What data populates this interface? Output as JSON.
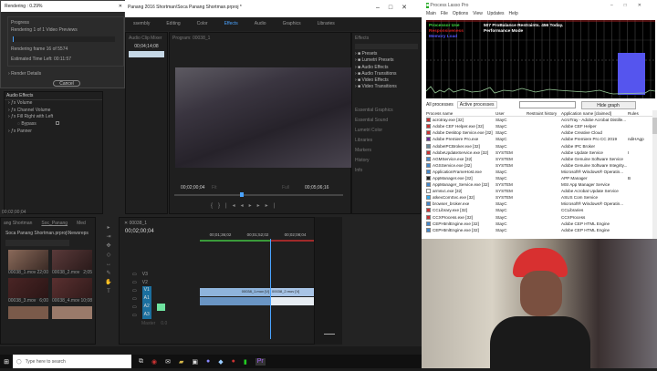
{
  "premiere": {
    "title": "Panang 2016 Shortman\\Soca Panang Shortman.prproj *",
    "workspaces": [
      "ssembly",
      "Editing",
      "Color",
      "Effects",
      "Audio",
      "Graphics",
      "Libraries"
    ],
    "audio_clip_mixer": {
      "title": "Audio Clip Mixer",
      "timecode": "00;04;14;08"
    },
    "program": {
      "title": "Program: 00038_1",
      "timecode_left": "00;02;00;04",
      "fit": "Fit",
      "quality": "Full",
      "timecode_right": "00;05;06;16"
    },
    "effects": {
      "title": "Effects",
      "items": [
        "Presets",
        "Lumetri Presets",
        "Audio Effects",
        "Audio Transitions",
        "Video Effects",
        "Video Transitions"
      ]
    },
    "side_panels": [
      "Essential Graphics",
      "Essential Sound",
      "Lumetri Color",
      "Libraries",
      "Markers",
      "History",
      "Info"
    ],
    "source_timecode": "00;02;00;04",
    "audio_effects": {
      "title": "Audio Effects",
      "items": [
        "Volume",
        "Channel Volume",
        "Fill Right with Left",
        "Bypass",
        "Panner"
      ]
    },
    "project": {
      "tabs": [
        "ang Shortman",
        "Soc_Panang",
        "Med"
      ],
      "path": "Soca Panang Shortman.prproj\\Newsreps",
      "clips": [
        {
          "name": "00038_1.mov",
          "dur": "22;00"
        },
        {
          "name": "00038_2.mov",
          "dur": "2;05"
        },
        {
          "name": "00038_3.mov",
          "dur": "6;00"
        },
        {
          "name": "00038_4.mov",
          "dur": "10;08"
        }
      ]
    },
    "timeline": {
      "tab": "00038_1",
      "timecode": "00;02;00;04",
      "ruler": [
        "00;01;36;02",
        "00;01;52;02",
        "00;02;08;04"
      ],
      "tracks": [
        "V3",
        "V2",
        "V1",
        "A1",
        "A2",
        "A3"
      ],
      "master": "Master",
      "master_val": "0.0",
      "clip1": "00038_1.mov [V]",
      "clip2": "00038_2.mov [V]"
    }
  },
  "render_dialog": {
    "title": "Rendering : 0.29%",
    "progress_label": "Progress",
    "line1": "Rendering 1 of 1 Video Previews",
    "line2": "Rendering frame 16 of 5574",
    "line3": "Estimated Time Left: 00:11:57",
    "details": "Render Details",
    "cancel": "Cancel",
    "progress": 0.29
  },
  "process_lasso": {
    "title": "Process Lasso Pro",
    "menu": [
      "Main",
      "File",
      "Options",
      "View",
      "Updates",
      "Help"
    ],
    "legend": [
      "Processor Use",
      "Responsiveness",
      "Memory Load"
    ],
    "status1": "507 ProBalance Restraints. 456 Today.",
    "status2": "Performance Mode",
    "tabs": [
      "All processes",
      "Active processes"
    ],
    "hide_graph": "Hide graph",
    "columns": [
      "Process name",
      "User",
      "Restraint history",
      "Application name [claimed]",
      "Rules"
    ],
    "rows": [
      [
        "acrotray.exe [32]",
        "StayC",
        "",
        "AcroTray - Adobe Acrobat Distille...",
        ""
      ],
      [
        "Adobe CEF Helper.exe [32]",
        "StayC",
        "",
        "Adobe CEF Helper",
        ""
      ],
      [
        "Adobe Desktop Service.exe [32]",
        "StayC",
        "",
        "Adobe Creative Cloud",
        ""
      ],
      [
        "Adobe Premiere Pro.exe",
        "StayC",
        "",
        "Adobe Premiere Pro CC 2019",
        "ndiHAgp"
      ],
      [
        "AdobeIPCBroker.exe [32]",
        "StayC",
        "",
        "Adobe IPC Broker",
        ""
      ],
      [
        "AdobeUpdateService.exe [32]",
        "SYSTEM",
        "",
        "Adobe Update Service",
        "I"
      ],
      [
        "AGMService.exe [32]",
        "SYSTEM",
        "",
        "Adobe Genuine Software Service",
        ""
      ],
      [
        "AGSService.exe [32]",
        "SYSTEM",
        "",
        "Adobe Genuine Software Integrity...",
        ""
      ],
      [
        "ApplicationFrameHost.exe",
        "StayC",
        "",
        "Microsoft® Windows® Operatin...",
        ""
      ],
      [
        "AppManager.exe [32]",
        "StayC",
        "",
        "APP Manager",
        "B"
      ],
      [
        "AppManager_Service.exe [32]",
        "SYSTEM",
        "",
        "MSI App Manager Service",
        ""
      ],
      [
        "armsvc.exe [32]",
        "SYSTEM",
        "",
        "Adobe Acrobat Update Service",
        ""
      ],
      [
        "atkexComSvc.exe [32]",
        "SYSTEM",
        "",
        "ASUS Com Service",
        ""
      ],
      [
        "browser_broker.exe",
        "StayC",
        "",
        "Microsoft® Windows® Operatin...",
        ""
      ],
      [
        "CCLibrary.exe [32]",
        "StayC",
        "",
        "CCLibraries",
        ""
      ],
      [
        "CCXProcess.exe [32]",
        "StayC",
        "",
        "CCXProcess",
        ""
      ],
      [
        "CEPHtmlEngine.exe [32]",
        "StayC",
        "",
        "Adobe CEP HTML Engine",
        ""
      ],
      [
        "CEPHtmlEngine.exe [32]",
        "StayC",
        "",
        "Adobe CEP HTML Engine",
        ""
      ]
    ]
  },
  "taskbar": {
    "search_placeholder": "Type here to search"
  },
  "colors": {
    "accent": "#4aa3ff",
    "cpu": "#3ddc3d",
    "resp": "#d02020",
    "mem": "#5555ff",
    "track": "#1b6f9e"
  }
}
